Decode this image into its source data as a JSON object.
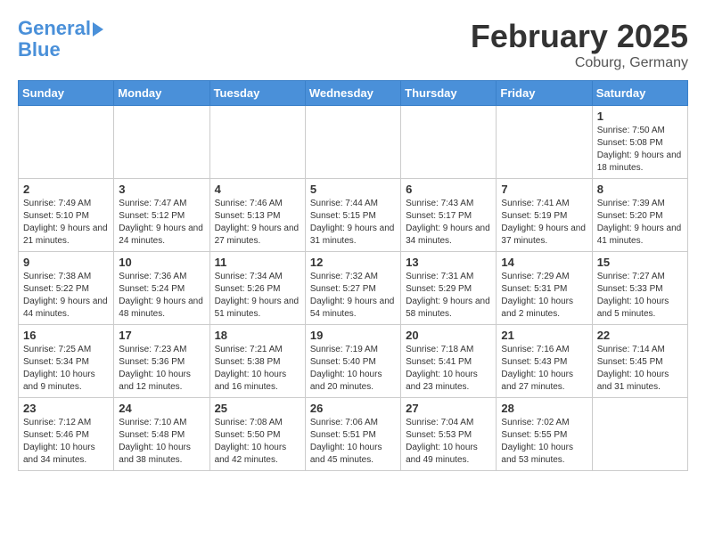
{
  "header": {
    "logo_line1": "General",
    "logo_line2": "Blue",
    "month": "February 2025",
    "location": "Coburg, Germany"
  },
  "weekdays": [
    "Sunday",
    "Monday",
    "Tuesday",
    "Wednesday",
    "Thursday",
    "Friday",
    "Saturday"
  ],
  "weeks": [
    [
      {
        "day": "",
        "info": ""
      },
      {
        "day": "",
        "info": ""
      },
      {
        "day": "",
        "info": ""
      },
      {
        "day": "",
        "info": ""
      },
      {
        "day": "",
        "info": ""
      },
      {
        "day": "",
        "info": ""
      },
      {
        "day": "1",
        "info": "Sunrise: 7:50 AM\nSunset: 5:08 PM\nDaylight: 9 hours and 18 minutes."
      }
    ],
    [
      {
        "day": "2",
        "info": "Sunrise: 7:49 AM\nSunset: 5:10 PM\nDaylight: 9 hours and 21 minutes."
      },
      {
        "day": "3",
        "info": "Sunrise: 7:47 AM\nSunset: 5:12 PM\nDaylight: 9 hours and 24 minutes."
      },
      {
        "day": "4",
        "info": "Sunrise: 7:46 AM\nSunset: 5:13 PM\nDaylight: 9 hours and 27 minutes."
      },
      {
        "day": "5",
        "info": "Sunrise: 7:44 AM\nSunset: 5:15 PM\nDaylight: 9 hours and 31 minutes."
      },
      {
        "day": "6",
        "info": "Sunrise: 7:43 AM\nSunset: 5:17 PM\nDaylight: 9 hours and 34 minutes."
      },
      {
        "day": "7",
        "info": "Sunrise: 7:41 AM\nSunset: 5:19 PM\nDaylight: 9 hours and 37 minutes."
      },
      {
        "day": "8",
        "info": "Sunrise: 7:39 AM\nSunset: 5:20 PM\nDaylight: 9 hours and 41 minutes."
      }
    ],
    [
      {
        "day": "9",
        "info": "Sunrise: 7:38 AM\nSunset: 5:22 PM\nDaylight: 9 hours and 44 minutes."
      },
      {
        "day": "10",
        "info": "Sunrise: 7:36 AM\nSunset: 5:24 PM\nDaylight: 9 hours and 48 minutes."
      },
      {
        "day": "11",
        "info": "Sunrise: 7:34 AM\nSunset: 5:26 PM\nDaylight: 9 hours and 51 minutes."
      },
      {
        "day": "12",
        "info": "Sunrise: 7:32 AM\nSunset: 5:27 PM\nDaylight: 9 hours and 54 minutes."
      },
      {
        "day": "13",
        "info": "Sunrise: 7:31 AM\nSunset: 5:29 PM\nDaylight: 9 hours and 58 minutes."
      },
      {
        "day": "14",
        "info": "Sunrise: 7:29 AM\nSunset: 5:31 PM\nDaylight: 10 hours and 2 minutes."
      },
      {
        "day": "15",
        "info": "Sunrise: 7:27 AM\nSunset: 5:33 PM\nDaylight: 10 hours and 5 minutes."
      }
    ],
    [
      {
        "day": "16",
        "info": "Sunrise: 7:25 AM\nSunset: 5:34 PM\nDaylight: 10 hours and 9 minutes."
      },
      {
        "day": "17",
        "info": "Sunrise: 7:23 AM\nSunset: 5:36 PM\nDaylight: 10 hours and 12 minutes."
      },
      {
        "day": "18",
        "info": "Sunrise: 7:21 AM\nSunset: 5:38 PM\nDaylight: 10 hours and 16 minutes."
      },
      {
        "day": "19",
        "info": "Sunrise: 7:19 AM\nSunset: 5:40 PM\nDaylight: 10 hours and 20 minutes."
      },
      {
        "day": "20",
        "info": "Sunrise: 7:18 AM\nSunset: 5:41 PM\nDaylight: 10 hours and 23 minutes."
      },
      {
        "day": "21",
        "info": "Sunrise: 7:16 AM\nSunset: 5:43 PM\nDaylight: 10 hours and 27 minutes."
      },
      {
        "day": "22",
        "info": "Sunrise: 7:14 AM\nSunset: 5:45 PM\nDaylight: 10 hours and 31 minutes."
      }
    ],
    [
      {
        "day": "23",
        "info": "Sunrise: 7:12 AM\nSunset: 5:46 PM\nDaylight: 10 hours and 34 minutes."
      },
      {
        "day": "24",
        "info": "Sunrise: 7:10 AM\nSunset: 5:48 PM\nDaylight: 10 hours and 38 minutes."
      },
      {
        "day": "25",
        "info": "Sunrise: 7:08 AM\nSunset: 5:50 PM\nDaylight: 10 hours and 42 minutes."
      },
      {
        "day": "26",
        "info": "Sunrise: 7:06 AM\nSunset: 5:51 PM\nDaylight: 10 hours and 45 minutes."
      },
      {
        "day": "27",
        "info": "Sunrise: 7:04 AM\nSunset: 5:53 PM\nDaylight: 10 hours and 49 minutes."
      },
      {
        "day": "28",
        "info": "Sunrise: 7:02 AM\nSunset: 5:55 PM\nDaylight: 10 hours and 53 minutes."
      },
      {
        "day": "",
        "info": ""
      }
    ]
  ]
}
